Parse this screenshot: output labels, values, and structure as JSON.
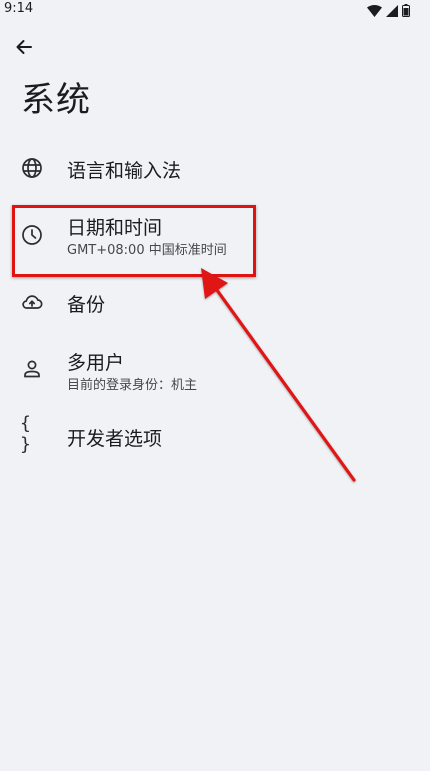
{
  "status": {
    "time": "9:14"
  },
  "page": {
    "title": "系统"
  },
  "items": [
    {
      "title": "语言和输入法",
      "icon": "globe-icon"
    },
    {
      "title": "日期和时间",
      "subtitle": "GMT+08:00 中国标准时间",
      "icon": "clock-icon"
    },
    {
      "title": "备份",
      "icon": "cloud-upload-icon"
    },
    {
      "title": "多用户",
      "subtitle": "目前的登录身份：机主",
      "icon": "person-icon"
    },
    {
      "title": "开发者选项",
      "icon": "braces-icon",
      "icon_text": "{ }"
    }
  ],
  "annotation": {
    "color": "#e01313"
  }
}
